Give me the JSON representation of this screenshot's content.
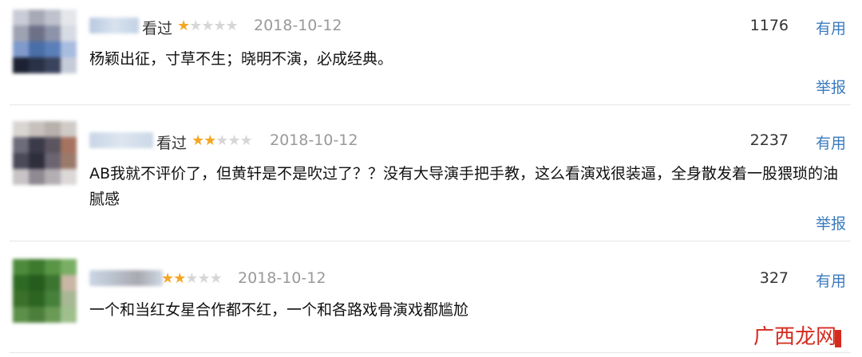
{
  "comments": [
    {
      "watched_label": "看过",
      "rating": 1,
      "date": "2018-10-12",
      "votes": "1176",
      "useful_label": "有用",
      "content": "杨颖出征，寸草不生；晓明不演，必成经典。",
      "report_label": "举报"
    },
    {
      "watched_label": "看过",
      "rating": 2,
      "date": "2018-10-12",
      "votes": "2237",
      "useful_label": "有用",
      "content": "AB我就不评价了，但黄轩是不是吹过了？？没有大导演手把手教，这么看演戏很装逼，全身散发着一股猥琐的油腻感",
      "report_label": "举报"
    },
    {
      "watched_label": "",
      "rating": 2,
      "date": "2018-10-12",
      "votes": "327",
      "useful_label": "有用",
      "content": "一个和当红女星合作都不红，一个和各路戏骨演戏都尴尬",
      "report_label": ""
    }
  ],
  "watermark": "广西龙网",
  "colors": {
    "link": "#3b7bbf",
    "star": "#f5a623",
    "star_empty": "#d6d6d6"
  }
}
